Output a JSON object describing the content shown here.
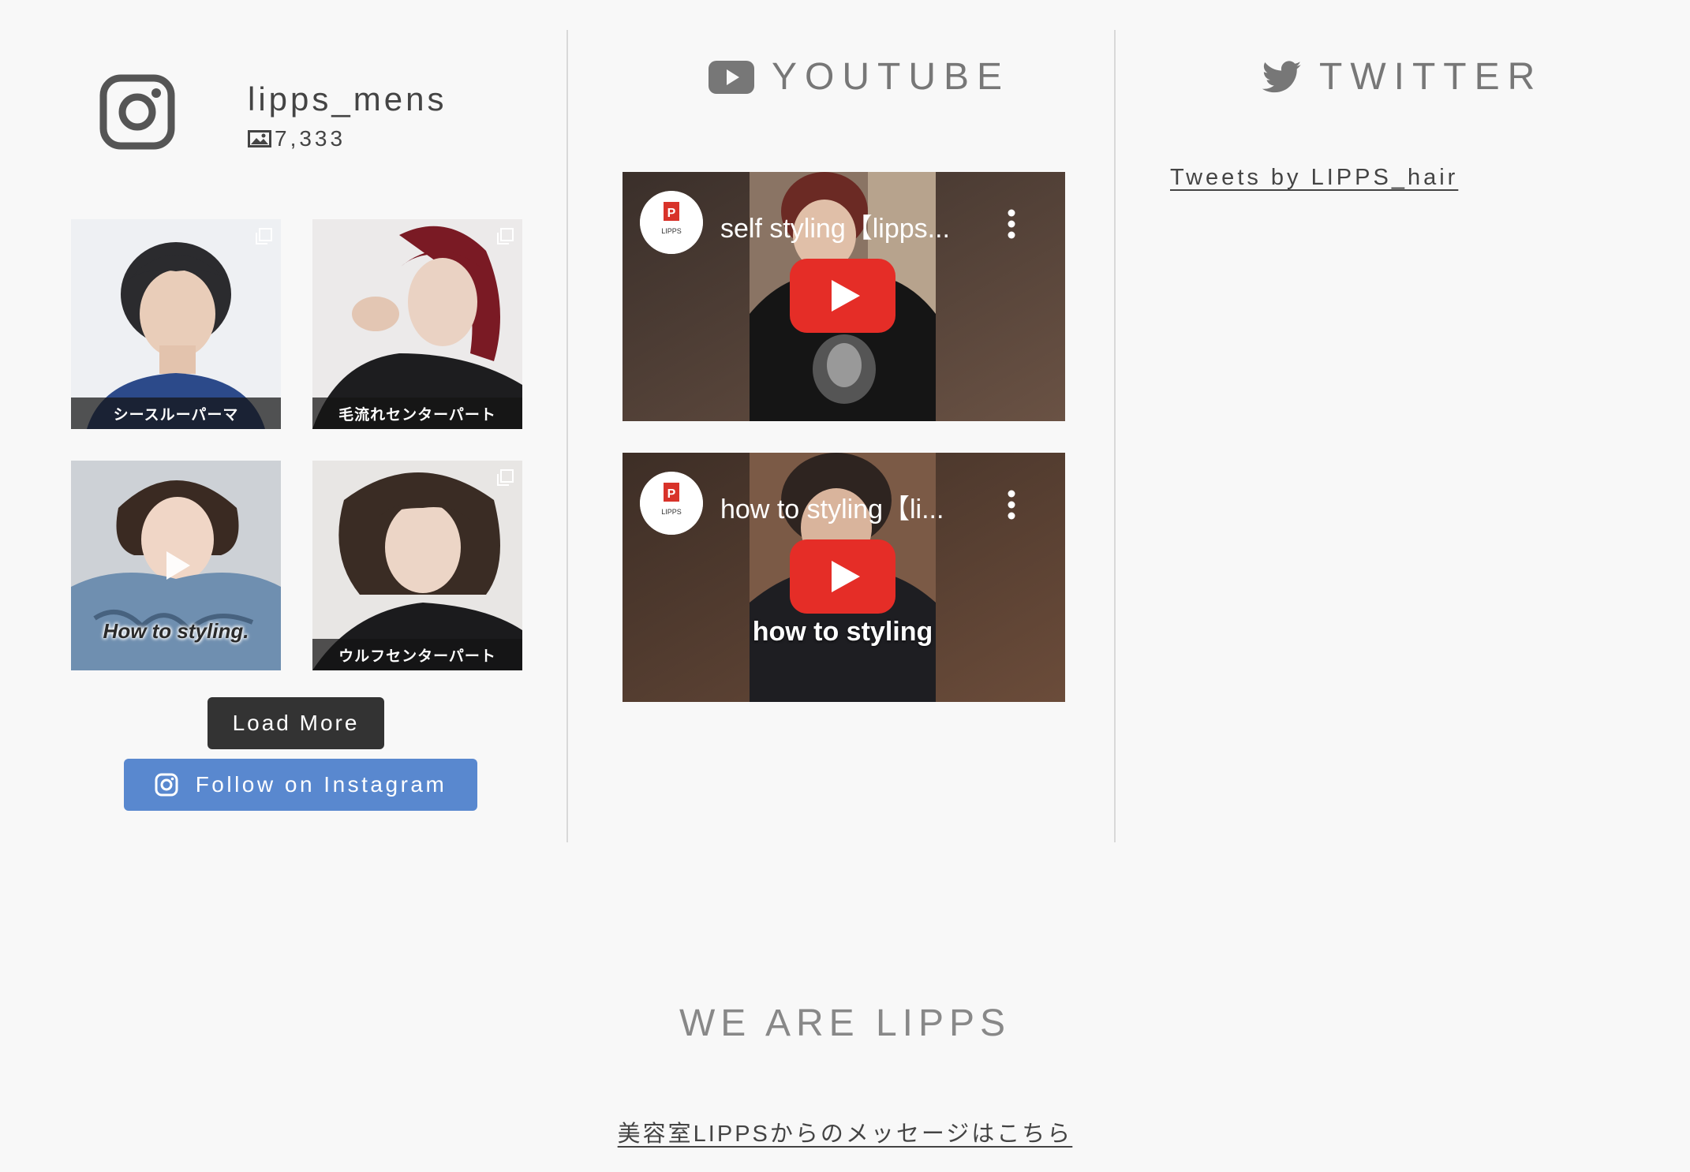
{
  "instagram": {
    "username": "lipps_mens",
    "post_count": "7,333",
    "posts": [
      {
        "caption": "シースルーパーマ",
        "type": "carousel"
      },
      {
        "caption": "毛流れセンターパート",
        "type": "carousel"
      },
      {
        "caption": "",
        "overlay_text": "How to styling.",
        "type": "video"
      },
      {
        "caption": "ウルフセンターパート",
        "type": "carousel"
      }
    ],
    "load_more_label": "Load More",
    "follow_label": "Follow on Instagram"
  },
  "youtube": {
    "heading": "YOUTUBE",
    "videos": [
      {
        "title": "self styling【lipps...",
        "thumb_caption": ""
      },
      {
        "title": "how to styling【li...",
        "thumb_caption": "how to styling"
      }
    ],
    "channel_avatar_text": "LIPPS"
  },
  "twitter": {
    "heading": "TWITTER",
    "tweets_link": "Tweets by LIPPS_hair"
  },
  "footer": {
    "heading": "WE ARE LIPPS",
    "message_link": "美容室LIPPSからのメッセージはこちら"
  },
  "colors": {
    "background": "#f8f8f8",
    "follow_button": "#5988cf",
    "load_more_button": "#333333",
    "youtube_red": "#e52d27"
  }
}
